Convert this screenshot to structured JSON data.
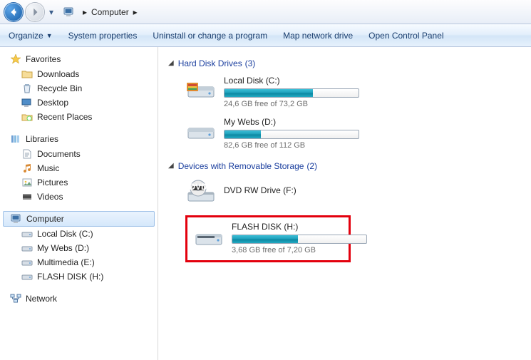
{
  "breadcrumb": {
    "root": "Computer"
  },
  "toolbar": {
    "organize": "Organize",
    "sysprops": "System properties",
    "uninstall": "Uninstall or change a program",
    "mapdrive": "Map network drive",
    "controlpanel": "Open Control Panel"
  },
  "sidebar": {
    "favorites": {
      "label": "Favorites",
      "items": [
        "Downloads",
        "Recycle Bin",
        "Desktop",
        "Recent Places"
      ]
    },
    "libraries": {
      "label": "Libraries",
      "items": [
        "Documents",
        "Music",
        "Pictures",
        "Videos"
      ]
    },
    "computer": {
      "label": "Computer",
      "items": [
        "Local Disk (C:)",
        "My Webs (D:)",
        "Multimedia (E:)",
        "FLASH DISK (H:)"
      ]
    },
    "network": {
      "label": "Network"
    }
  },
  "sections": {
    "hdd": {
      "title": "Hard Disk Drives",
      "count": "(3)"
    },
    "rem": {
      "title": "Devices with Removable Storage",
      "count": "(2)"
    }
  },
  "drives": {
    "c": {
      "name": "Local Disk (C:)",
      "free": "24,6 GB free of 73,2 GB",
      "pct": 66
    },
    "d": {
      "name": "My Webs (D:)",
      "free": "82,6 GB free of 112 GB",
      "pct": 27
    },
    "dvd": {
      "name": "DVD RW Drive (F:)"
    },
    "h": {
      "name": "FLASH DISK (H:)",
      "free": "3,68 GB free of 7,20 GB",
      "pct": 49
    }
  }
}
